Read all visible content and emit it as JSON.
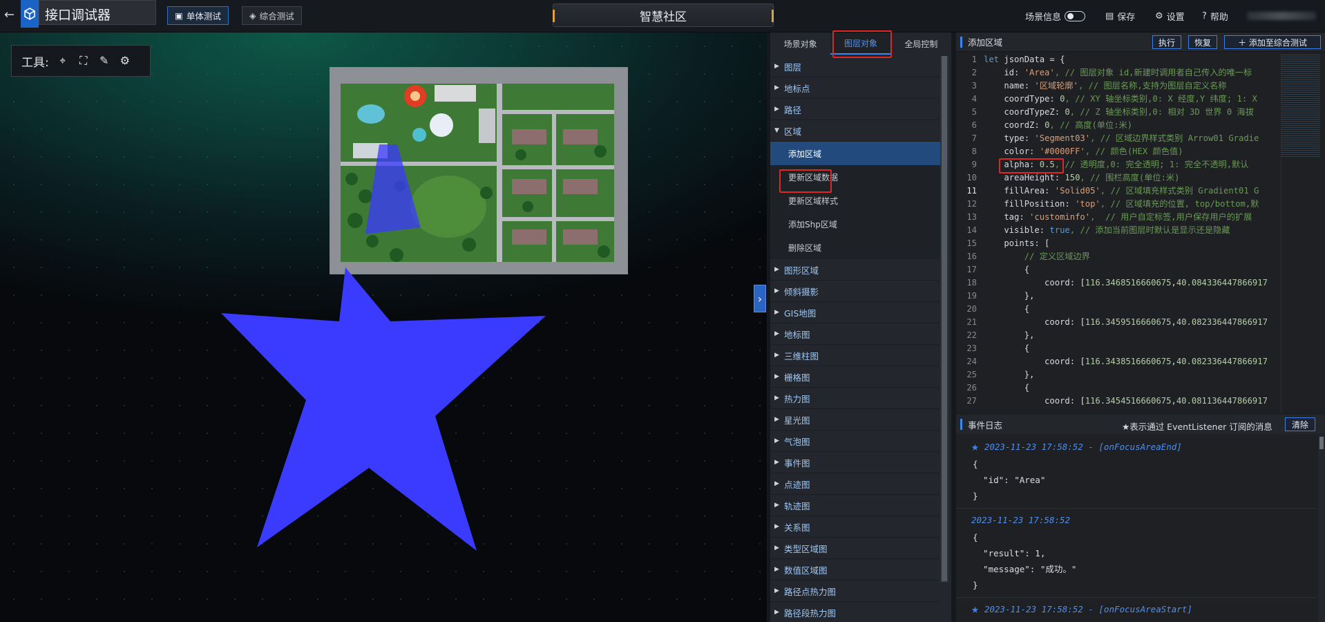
{
  "topbar": {
    "app_title": "接口调试器",
    "modes": [
      "单体测试",
      "综合测试"
    ],
    "scene_title": "智慧社区",
    "scene_info_label": "场景信息",
    "save_label": "保存",
    "settings_label": "设置",
    "help_label": "帮助"
  },
  "viewport": {
    "tools_label": "工具:"
  },
  "panel": {
    "tabs": [
      "场景对象",
      "图层对象",
      "全局控制"
    ],
    "tree": [
      "图层",
      "地标点",
      "路径",
      "区域"
    ],
    "area_sub": [
      "添加区域",
      "更新区域数据",
      "更新区域样式",
      "添加Shp区域",
      "删除区域"
    ],
    "tree_after": [
      "图形区域",
      "倾斜摄影",
      "GIS地图",
      "地标图",
      "三维柱图",
      "栅格图",
      "热力图",
      "星光图",
      "气泡图",
      "事件图",
      "点迹图",
      "轨迹图",
      "关系图",
      "类型区域图",
      "数值区域图",
      "路径点热力图",
      "路径段热力图"
    ]
  },
  "editor": {
    "title": "添加区域",
    "run_label": "执行",
    "reset_label": "恢复",
    "add_label": "添加至综合测试",
    "lines": [
      {
        "k": "let",
        "r": " jsonData = {"
      },
      {
        "r": "    id: ",
        "s": "'Area'",
        "c": ", // 图层对象 id,新建时调用者自己传入的唯一标"
      },
      {
        "r": "    name: ",
        "s": "'区域轮廓'",
        "c": ", // 图层名称,支持为图层自定义名称"
      },
      {
        "r": "    coordType: ",
        "n": "0",
        "c": ", // XY 轴坐标类别,0: X 经度,Y 纬度; 1: X"
      },
      {
        "r": "    coordTypeZ: ",
        "n": "0",
        "c": ", // Z 轴坐标类别,0: 相对 3D 世界 0 海拔"
      },
      {
        "r": "    coordZ: ",
        "n": "0",
        "c": ", // 高度(单位:米)"
      },
      {
        "r": "    type: ",
        "s": "'Segment03'",
        "c": ", // 区域边界样式类别 Arrow01 Gradie"
      },
      {
        "r": "    color: ",
        "s": "'#0000FF'",
        "c": ", // 颜色(HEX 颜色值)"
      },
      {
        "r": "    alpha: ",
        "n": "0.5",
        "c": ", // 透明度,0: 完全透明; 1: 完全不透明,默认"
      },
      {
        "r": "    areaHeight: ",
        "n": "150",
        "c": ", // 围栏高度(单位:米)"
      },
      {
        "r": "    fillArea: ",
        "s": "'Solid05'",
        "c": ", // 区域填充样式类别 Gradient01 G"
      },
      {
        "r": "    fillPosition: ",
        "s": "'top'",
        "c": ", // 区域填充的位置, top/bottom,默"
      },
      {
        "r": "    tag: ",
        "s": "'custominfo'",
        "c": ",  // 用户自定标签,用户保存用户的扩展"
      },
      {
        "r": "    visible: ",
        "k2": "true",
        "c": ", // 添加当前图层时默认是显示还是隐藏"
      },
      {
        "r": "    points: ["
      },
      {
        "c2": "        // 定义区域边界"
      },
      {
        "r": "        {"
      },
      {
        "r": "            coord: [",
        "n": "116.3468516660675",
        "r2": ",",
        "n2": "40.084336447866917"
      },
      {
        "r": "        },"
      },
      {
        "r": "        {"
      },
      {
        "r": "            coord: [",
        "n": "116.3459516660675",
        "r2": ",",
        "n2": "40.082336447866917"
      },
      {
        "r": "        },"
      },
      {
        "r": "        {"
      },
      {
        "r": "            coord: [",
        "n": "116.3438516660675",
        "r2": ",",
        "n2": "40.082336447866917"
      },
      {
        "r": "        },"
      },
      {
        "r": "        {"
      },
      {
        "r": "            coord: [",
        "n": "116.3454516660675",
        "r2": ",",
        "n2": "40.081136447866917"
      }
    ]
  },
  "log": {
    "title": "事件日志",
    "note": "★表示通过 EventListener 订阅的消息",
    "clear_label": "清除",
    "entries": [
      {
        "time": "2023-11-23 17:58:52 - [onFocusAreaEnd]",
        "starred": true,
        "json": "{\n  \"id\": \"Area\"\n}"
      },
      {
        "time": "2023-11-23 17:58:52",
        "starred": false,
        "json": "{\n  \"result\": 1,\n  \"message\": \"成功。\"\n}"
      },
      {
        "time": "2023-11-23 17:58:52 - [onFocusAreaStart]",
        "starred": true,
        "json": "{"
      }
    ]
  },
  "colors": {
    "accent": "#3e86f0",
    "highlight": "#e12626",
    "star_fill": "#3b3bff"
  }
}
